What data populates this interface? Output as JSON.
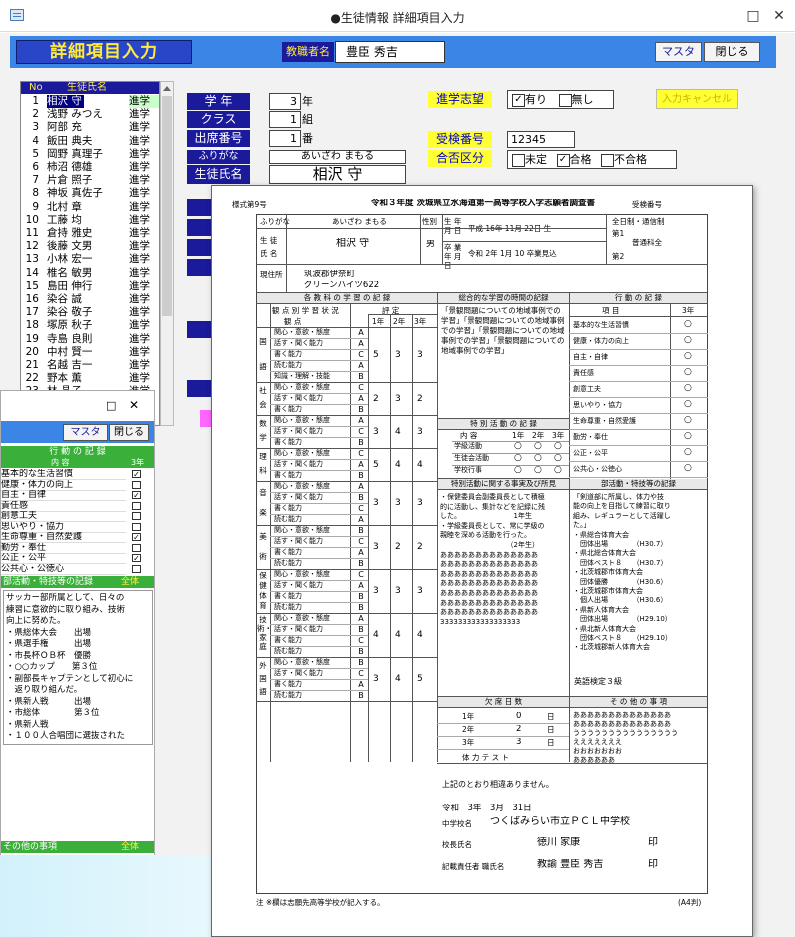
{
  "window": {
    "title": "●生徒情報 詳細項目入力",
    "minimize": "□",
    "close": "✕"
  },
  "header": {
    "form_title": "詳細項目入力",
    "teacher_label": "教職者名",
    "teacher_value": "豊臣 秀吉",
    "master_button": "マスタ",
    "close_button": "閉じる"
  },
  "student_list": {
    "col_no": "No",
    "col_name": "生徒氏名",
    "rows": [
      {
        "no": "1",
        "name": "相沢 守",
        "status": "進学"
      },
      {
        "no": "2",
        "name": "浅野 みつえ",
        "status": "進学"
      },
      {
        "no": "3",
        "name": "阿部 充",
        "status": "進学"
      },
      {
        "no": "4",
        "name": "飯田 典夫",
        "status": "進学"
      },
      {
        "no": "5",
        "name": "岡野 真理子",
        "status": "進学"
      },
      {
        "no": "6",
        "name": "柿沼 德雄",
        "status": "進学"
      },
      {
        "no": "7",
        "name": "片倉 照子",
        "status": "進学"
      },
      {
        "no": "8",
        "name": "神坂 真佐子",
        "status": "進学"
      },
      {
        "no": "9",
        "name": "北村 章",
        "status": "進学"
      },
      {
        "no": "10",
        "name": "工藤 均",
        "status": "進学"
      },
      {
        "no": "11",
        "name": "倉持 雅史",
        "status": "進学"
      },
      {
        "no": "12",
        "name": "後藤 文男",
        "status": "進学"
      },
      {
        "no": "13",
        "name": "小林 宏一",
        "status": "進学"
      },
      {
        "no": "14",
        "name": "椎名 敏男",
        "status": "進学"
      },
      {
        "no": "15",
        "name": "島田 伸行",
        "status": "進学"
      },
      {
        "no": "16",
        "name": "染谷 誠",
        "status": "進学"
      },
      {
        "no": "17",
        "name": "染谷 敬子",
        "status": "進学"
      },
      {
        "no": "18",
        "name": "塚原 秋子",
        "status": "進学"
      },
      {
        "no": "19",
        "name": "寺島 良則",
        "status": "進学"
      },
      {
        "no": "20",
        "name": "中村 賢一",
        "status": "進学"
      },
      {
        "no": "21",
        "name": "名越 吉一",
        "status": "進学"
      },
      {
        "no": "22",
        "name": "野本 薫",
        "status": "進学"
      },
      {
        "no": "23",
        "name": "林 晶子",
        "status": "進学"
      }
    ]
  },
  "form": {
    "grade_label": "学 年",
    "grade_value": "3",
    "grade_unit": "年",
    "class_label": "クラス",
    "class_value": "1",
    "class_unit": "組",
    "seat_label": "出席番号",
    "seat_value": "1",
    "seat_unit": "番",
    "furigana_label": "ふりがな",
    "name_label": "生徒氏名",
    "furigana_value": "あいざわ まもる",
    "name_value": "相沢 守",
    "aspiration_label": "進学志望",
    "aspiration_yes": "有り",
    "aspiration_no": "無し",
    "cancel_button": "入力キャンセル",
    "exam_no_label": "受検番号",
    "exam_no_value": "12345",
    "result_label": "合否区分",
    "result_undecided": "未定",
    "result_pass": "合格",
    "result_fail": "不合格"
  },
  "win2": {
    "close": "✕",
    "minimize": "□",
    "master_button": "マスタ",
    "close_button": "閉じる",
    "behavior_header": "行 動 の 記 録",
    "content_label": "内 容",
    "grade3": "3年",
    "items": [
      {
        "label": "基本的な生活習慣",
        "checked": true
      },
      {
        "label": "健康・体力の向上",
        "checked": false
      },
      {
        "label": "自主・自律",
        "checked": true
      },
      {
        "label": "責任感",
        "checked": false
      },
      {
        "label": "創意工夫",
        "checked": false
      },
      {
        "label": "思いやり・協力",
        "checked": false
      },
      {
        "label": "生命尊重・自然愛護",
        "checked": true
      },
      {
        "label": "勤労・奉仕",
        "checked": false
      },
      {
        "label": "公正・公平",
        "checked": true
      },
      {
        "label": "公共心・公徳心",
        "checked": false
      }
    ],
    "special_header": "部活動・特技等の記録",
    "special_tag": "全体",
    "special_lines": [
      "サッカー部所属として、日々の",
      "練習に意欲的に取り組み、技術",
      "向上に努めた。",
      "・県総体大会　　出場",
      "・県選手権　　　出場",
      "・市長杯ＯＢ杯　優勝",
      "・○○カップ　　第３位",
      "・副部長キャプテンとして初心に",
      "　返り取り組んだ。",
      "・県新人戦　　　出場",
      "・市総体　　　　第３位",
      "・県新人戦",
      "・１００人合唱団に選抜された"
    ],
    "other_header": "その他の事項",
    "other_tag": "全体"
  },
  "report": {
    "title": "令和３年度 茨城県立水海道第一高等学校入学志願者調査書",
    "form_no": "様式第9号",
    "exam_no_label": "受検番号",
    "furigana_label": "ふりがな",
    "furigana_value": "あいざわ まもる",
    "name_label": "氏 名",
    "student_label": "生 徒",
    "name_value": "相沢 守",
    "sex_label": "性別",
    "sex_value": "男",
    "birth_label": "生 年 月 日",
    "birth_value": "平成 16年 11月 22日 生",
    "grad_label": "卒 業 年 月 日",
    "grad_value": "令和 2年 1月 10 卒業見込",
    "school_first": "第1",
    "school_first_course": "普通科全",
    "school_second": "第2",
    "school_course": "全日制・通信制",
    "address_label": "現住所",
    "address_value": "筑波郡伊奈町",
    "address_line2": "グリーンハイツ622",
    "subjects_header": "各 教 科 の 学 習 の 記 録",
    "inquiry_header": "総合的な学習の時間の記録",
    "behavior_header": "行 動 の 記 録",
    "kanten_label": "観 点 別 学 習 状 況",
    "hyotei_label": "評 定",
    "kanten_col": "観 点",
    "years": [
      "1年",
      "2年",
      "3年"
    ],
    "subjects": [
      {
        "name": "国語",
        "marks": [
          "A",
          "A",
          "C",
          "A",
          "B"
        ],
        "grades": [
          "5",
          "3",
          "3"
        ]
      },
      {
        "name": "社会",
        "marks": [
          "C",
          "A",
          "B"
        ],
        "grades": [
          "2",
          "3",
          "2"
        ]
      },
      {
        "name": "数学",
        "marks": [
          "A",
          "C",
          "B"
        ],
        "grades": [
          "3",
          "4",
          "3"
        ]
      },
      {
        "name": "理科",
        "marks": [
          "C",
          "A",
          "B"
        ],
        "grades": [
          "5",
          "4",
          "4"
        ]
      },
      {
        "name": "音楽",
        "marks": [
          "A",
          "B",
          "C",
          "A"
        ],
        "grades": [
          "3",
          "3",
          "3"
        ]
      },
      {
        "name": "美術",
        "marks": [
          "B",
          "C",
          "A",
          "B"
        ],
        "grades": [
          "3",
          "2",
          "2"
        ]
      },
      {
        "name": "保健体育",
        "marks": [
          "C",
          "A",
          "B",
          "B"
        ],
        "grades": [
          "3",
          "3",
          "3"
        ]
      },
      {
        "name": "技術・家庭",
        "marks": [
          "A",
          "B",
          "C",
          "B"
        ],
        "grades": [
          "4",
          "4",
          "4"
        ]
      },
      {
        "name": "外国語",
        "marks": [
          "B",
          "C",
          "A",
          "B"
        ],
        "grades": [
          "3",
          "4",
          "5"
        ]
      }
    ],
    "kanten_items": [
      "関心・意欲・態度",
      "話す・聞く能力",
      "書く能力",
      "読む能力",
      "知識・理解・技能"
    ],
    "inquiry_text": "「景観問題についての地域事例での学習」「景観問題についての地域事例での学習」「景観問題についての地域事例での学習」「景観問題についての地域事例での学習」",
    "special_activity_header": "特 別 活 動 の 記 録",
    "special_rows": [
      {
        "label": "学級活動",
        "marks": [
          "○",
          "○",
          "○"
        ]
      },
      {
        "label": "生徒会活動",
        "marks": [
          "○",
          "○",
          "○"
        ]
      },
      {
        "label": "学校行事",
        "marks": [
          "○",
          "○",
          "○"
        ]
      }
    ],
    "special_col": "内 容",
    "behavior_items": [
      {
        "label": "基本的な生活習慣",
        "mark": "○"
      },
      {
        "label": "健康・体力の向上",
        "mark": "○"
      },
      {
        "label": "自主・自律",
        "mark": "○"
      },
      {
        "label": "責任感",
        "mark": "○"
      },
      {
        "label": "創意工夫",
        "mark": "○"
      },
      {
        "label": "思いやり・協力",
        "mark": "○"
      },
      {
        "label": "生命尊重・自然愛護",
        "mark": "○"
      },
      {
        "label": "勤労・奉仕",
        "mark": "○"
      },
      {
        "label": "公正・公平",
        "mark": "○"
      },
      {
        "label": "公共心・公徳心",
        "mark": "○"
      }
    ],
    "behavior_col_item": "項 目",
    "behavior_col_year": "3年",
    "special_facts_header": "特別活動に関する事実及び所見",
    "special_facts_text": [
      "・保健委員会副委員長として積極",
      "的に活動し、集計などを記録に残",
      "した。　　　　　　　　1年生",
      "・学級委員長として、常に学級の",
      "親睦を深める活動を行った。",
      "　　　　　　　　　　（2年生）",
      "ああああああああああああああ",
      "ああああああああああああああ",
      "ああああああああああああああ",
      "ああああああああああああああ",
      "ああああああああああああああ",
      "ああああああああああああああ",
      "ああああああああああああああ",
      "333333333333333333"
    ],
    "club_header": "部活動・特技等の記録",
    "club_text": [
      "「剣道部に所属し、体力や技",
      "能の向上を目指して練習に取り",
      "組み、レギュラーとして活躍し",
      "た。」",
      "・県総合体育大会",
      "　団体出場　　　　（H30.7）",
      "・県北総合体育大会",
      "　団体ベスト８　　（H30.7）",
      "・北茨城郡市体育大会",
      "　団体優勝　　　　（H30.6）",
      "・北茨城郡市体育大会",
      "　個人出場　　　　（H30.6）",
      "・県新人体育大会",
      "　団体出場　　　　（H29.10）",
      "・県北新人体育大会",
      "　団体ベスト８　　（H29.10）",
      "・北茨城郡新人体育大会"
    ],
    "eiken": "英語検定３級",
    "attendance_header": "欠 席 日 数",
    "attendance": [
      {
        "year": "1年",
        "days": "0",
        "unit": "日"
      },
      {
        "year": "2年",
        "days": "2",
        "unit": "日"
      },
      {
        "year": "3年",
        "days": "3",
        "unit": "日"
      }
    ],
    "fitness_label": "体 力 テ ス ト",
    "other_header": "そ の 他 の 事 項",
    "other_text": [
      "ああああああああああああああ",
      "ああああああああああああああ",
      "ううううううううううううううう",
      "えええええええ",
      "おおおおおおお",
      "ああああああ"
    ],
    "certify_text": "上記のとおり相違ありません。",
    "date_text": "令和　3年　3月　31日",
    "school_label": "中学校名",
    "school_name": "つくばみらい市立ＰＣＬ中学校",
    "principal_label": "校長氏名",
    "principal_name": "徳川 家康",
    "seal": "印",
    "recorder_label": "記載責任者 職氏名",
    "recorder_name": "教諭 豊臣 秀吉",
    "footer_note": "注 ※欄は志願先高等学校が記入する。",
    "paper_size": "(A4判)"
  }
}
